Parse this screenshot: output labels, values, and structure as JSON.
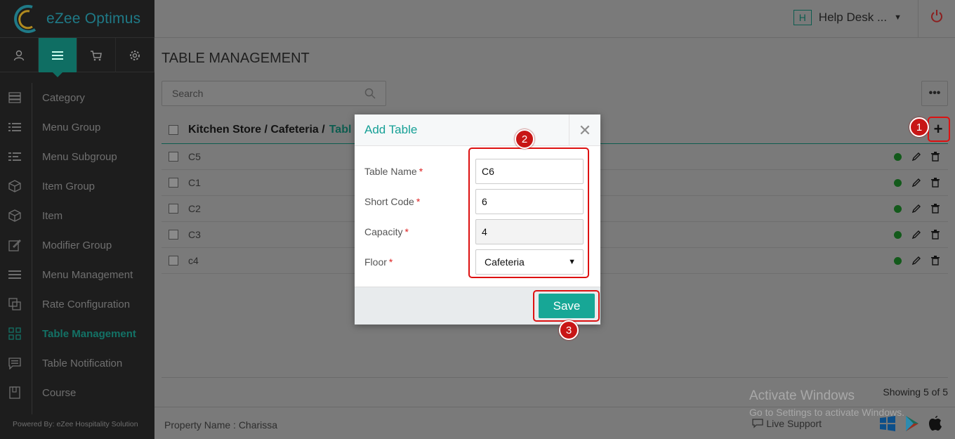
{
  "app": {
    "brand": "eZee Optimus",
    "powered_by": "Powered By: eZee Hospitality Solution"
  },
  "topbar": {
    "help_badge": "H",
    "help_label": "Help Desk ..."
  },
  "sidebar": {
    "tabs": [
      "user-icon",
      "menu-icon",
      "cart-icon",
      "gear-icon"
    ],
    "items": [
      {
        "label": "Category"
      },
      {
        "label": "Menu Group"
      },
      {
        "label": "Menu Subgroup"
      },
      {
        "label": "Item Group"
      },
      {
        "label": "Item"
      },
      {
        "label": "Modifier Group"
      },
      {
        "label": "Menu Management"
      },
      {
        "label": "Rate Configuration"
      },
      {
        "label": "Table Management"
      },
      {
        "label": "Table Notification"
      },
      {
        "label": "Course"
      }
    ]
  },
  "page": {
    "title": "TABLE MANAGEMENT",
    "search_placeholder": "Search",
    "breadcrumb": {
      "path": "Kitchen Store / Cafeteria /",
      "current": "Tabl"
    },
    "rows": [
      {
        "name": "C5"
      },
      {
        "name": "C1"
      },
      {
        "name": "C2"
      },
      {
        "name": "C3"
      },
      {
        "name": "c4"
      }
    ],
    "showing": "Showing 5 of 5"
  },
  "footer": {
    "property": "Property Name : Charissa",
    "live_support": "Live Support"
  },
  "watermark": {
    "line1": "Activate Windows",
    "line2": "Go to Settings to activate Windows."
  },
  "modal": {
    "title": "Add Table",
    "fields": {
      "table_name": {
        "label": "Table Name",
        "value": "C6"
      },
      "short_code": {
        "label": "Short Code",
        "value": "6"
      },
      "capacity": {
        "label": "Capacity",
        "value": "4"
      },
      "floor": {
        "label": "Floor",
        "value": "Cafeteria"
      }
    },
    "required_mark": "*",
    "save_label": "Save"
  },
  "annotations": [
    "1",
    "2",
    "3"
  ],
  "colors": {
    "accent": "#17a796",
    "annotation": "#c81616",
    "sidebar": "#1d1d1d"
  }
}
